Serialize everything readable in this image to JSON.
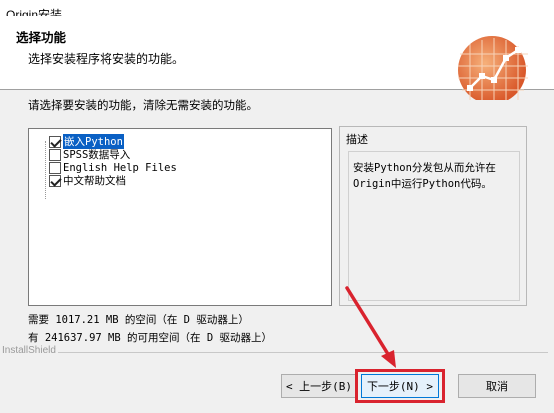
{
  "window": {
    "title": "Origin安装"
  },
  "header": {
    "title": "选择功能",
    "subtitle": "选择安装程序将安装的功能。"
  },
  "instruction": "请选择要安装的功能，清除无需安装的功能。",
  "features": [
    {
      "label": "嵌入Python",
      "checked": true,
      "selected": true
    },
    {
      "label": "SPSS数据导入",
      "checked": false,
      "selected": false
    },
    {
      "label": "English Help Files",
      "checked": false,
      "selected": false
    },
    {
      "label": "中文帮助文档",
      "checked": true,
      "selected": false
    }
  ],
  "description": {
    "title": "描述",
    "text": "安装Python分发包从而允许在Origin中运行Python代码。"
  },
  "space": {
    "required": "需要 1017.21 MB 的空间（在 D 驱动器上）",
    "available": "有 241637.97 MB 的可用空间（在 D 驱动器上）"
  },
  "brand": "InstallShield",
  "buttons": {
    "back": "< 上一步(B)",
    "next": "下一步(N) >",
    "cancel": "取消"
  },
  "colors": {
    "highlight": "#d9232e",
    "selection": "#0a60c4"
  }
}
